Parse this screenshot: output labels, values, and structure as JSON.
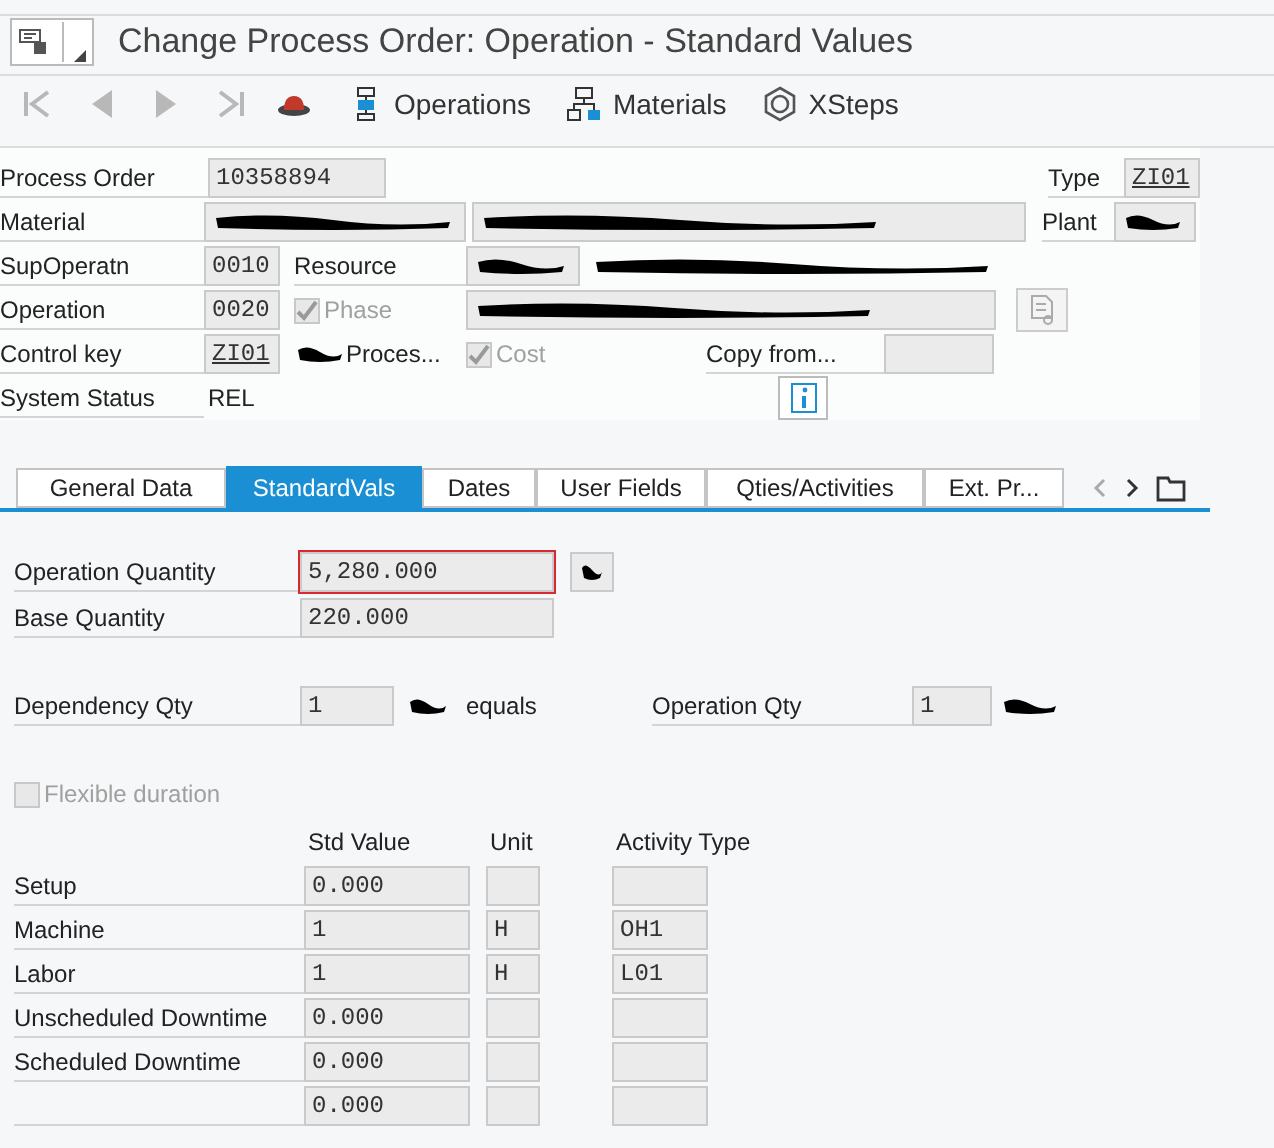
{
  "window": {
    "title": "Change Process Order: Operation -  Standard Values"
  },
  "toolbar": [
    {
      "kind": "first"
    },
    {
      "kind": "prev"
    },
    {
      "kind": "next"
    },
    {
      "kind": "last"
    },
    {
      "kind": "hat"
    },
    {
      "kind": "operations",
      "label": "Operations"
    },
    {
      "kind": "materials",
      "label": "Materials"
    },
    {
      "kind": "xsteps",
      "label": "XSteps"
    }
  ],
  "header": {
    "process_order": {
      "label": "Process Order",
      "value": "10358894"
    },
    "type": {
      "label": "Type",
      "value": "ZI01"
    },
    "material": {
      "label": "Material",
      "redacted": true,
      "description_redacted": true
    },
    "plant": {
      "label": "Plant",
      "redacted": true
    },
    "sup_operation": {
      "label": "SupOperatn",
      "value": "0010"
    },
    "resource": {
      "label": "Resource",
      "redacted": true,
      "description_redacted": true
    },
    "operation": {
      "label": "Operation",
      "value": "0020",
      "description_redacted": true
    },
    "phase": {
      "label": "Phase",
      "checked": true,
      "disabled": true
    },
    "control_key": {
      "label": "Control key",
      "value": "ZI01",
      "text": "Proces...",
      "text_redacted": true
    },
    "cost": {
      "label": "Cost",
      "checked": true,
      "disabled": true
    },
    "copy_from": {
      "label": "Copy from..."
    },
    "system_status": {
      "label": "System Status",
      "value": "REL"
    }
  },
  "tabs": [
    {
      "label": "General Data",
      "selected": false
    },
    {
      "label": "StandardVals",
      "selected": true
    },
    {
      "label": "Dates",
      "selected": false
    },
    {
      "label": "User Fields",
      "selected": false
    },
    {
      "label": "Qties/Activities",
      "selected": false
    },
    {
      "label": "Ext. Pr...",
      "selected": false
    }
  ],
  "standard_values": {
    "operation_quantity": {
      "label": "Operation Quantity",
      "value": "5,280.000",
      "focused": true,
      "unit_redacted": true
    },
    "base_quantity": {
      "label": "Base Quantity",
      "value": "220.000"
    },
    "dependency_qty": {
      "label": "Dependency Qty",
      "value": "1",
      "unit_redacted": true,
      "equals": "equals"
    },
    "dependent_operation_qty": {
      "label": "Operation Qty",
      "value": "1",
      "unit_redacted": true
    },
    "flexible_duration": {
      "label": "Flexible duration",
      "checked": false,
      "disabled": true
    },
    "columns": [
      "Std Value",
      "Unit",
      "Activity Type"
    ],
    "rows": [
      {
        "label": "Setup",
        "std_value": "0.000"
      },
      {
        "label": "Machine",
        "std_value": "1",
        "unit": "H",
        "activity_type": "OH1"
      },
      {
        "label": "Labor",
        "std_value": "1",
        "unit": "H",
        "activity_type": "L01"
      },
      {
        "label": "Unscheduled Downtime",
        "std_value": "0.000"
      },
      {
        "label": "Scheduled Downtime",
        "std_value": "0.000"
      },
      {
        "std_value": "0.000"
      }
    ]
  }
}
